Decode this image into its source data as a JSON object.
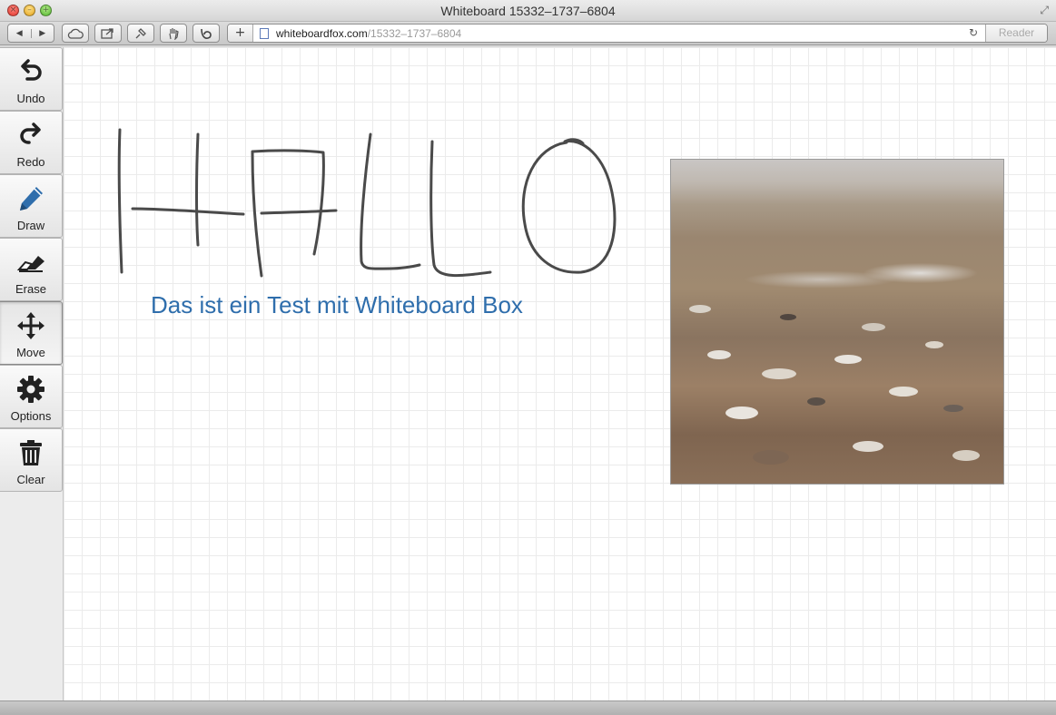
{
  "window": {
    "title": "Whiteboard 15332–1737–6804"
  },
  "browser": {
    "url_host": "whiteboardfox.com",
    "url_path": "/15332–1737–6804",
    "reader_label": "Reader",
    "toolbar_icons": [
      "back-icon",
      "forward-icon",
      "cloud-icon",
      "share-icon",
      "pin-icon",
      "hand-icon",
      "bookmark-icon",
      "add-tab-icon",
      "reload-icon"
    ]
  },
  "tools": [
    {
      "id": "undo",
      "label": "Undo",
      "icon": "undo-icon"
    },
    {
      "id": "redo",
      "label": "Redo",
      "icon": "redo-icon"
    },
    {
      "id": "draw",
      "label": "Draw",
      "icon": "pencil-icon"
    },
    {
      "id": "erase",
      "label": "Erase",
      "icon": "eraser-icon"
    },
    {
      "id": "move",
      "label": "Move",
      "icon": "move-arrows-icon",
      "active": true
    },
    {
      "id": "options",
      "label": "Options",
      "icon": "gear-icon"
    },
    {
      "id": "clear",
      "label": "Clear",
      "icon": "trash-icon"
    }
  ],
  "canvas": {
    "text_note": "Das ist ein Test mit Whiteboard Box",
    "text_color": "#2f6eac",
    "stroke_color": "#4a4a4a",
    "grid_color": "#ebebeb"
  }
}
